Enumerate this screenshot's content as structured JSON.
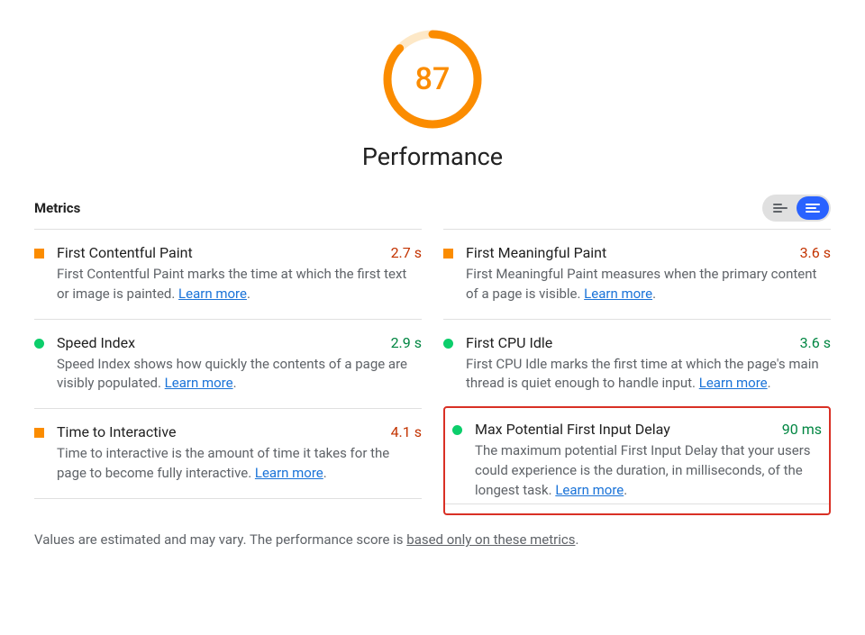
{
  "score": "87",
  "category": "Performance",
  "metrics_label": "Metrics",
  "learn_more": "Learn more",
  "footnote_pre": "Values are estimated and may vary. The performance score is ",
  "footnote_link": "based only on these metrics",
  "footnote_post": ".",
  "left": [
    {
      "title": "First Contentful Paint",
      "value": "2.7 s",
      "status": "orange",
      "desc": "First Contentful Paint marks the time at which the first text or image is painted. "
    },
    {
      "title": "Speed Index",
      "value": "2.9 s",
      "status": "green",
      "desc": "Speed Index shows how quickly the contents of a page are visibly populated. "
    },
    {
      "title": "Time to Interactive",
      "value": "4.1 s",
      "status": "orange",
      "desc": "Time to interactive is the amount of time it takes for the page to become fully interactive. "
    }
  ],
  "right": [
    {
      "title": "First Meaningful Paint",
      "value": "3.6 s",
      "status": "orange",
      "desc": "First Meaningful Paint measures when the primary content of a page is visible. "
    },
    {
      "title": "First CPU Idle",
      "value": "3.6 s",
      "status": "green",
      "desc": "First CPU Idle marks the first time at which the page's main thread is quiet enough to handle input. "
    },
    {
      "title": "Max Potential First Input Delay",
      "value": "90 ms",
      "status": "green",
      "desc": "The maximum potential First Input Delay that your users could experience is the duration, in milliseconds, of the longest task. ",
      "highlight": true
    }
  ]
}
